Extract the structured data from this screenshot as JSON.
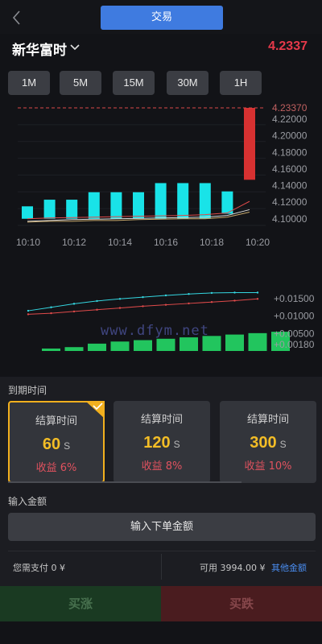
{
  "header": {
    "tab_label": "交易"
  },
  "symbol": {
    "name": "新华富时",
    "price": "4.2337"
  },
  "timeframes": [
    {
      "label": "1M",
      "active": true
    },
    {
      "label": "5M",
      "active": false
    },
    {
      "label": "15M",
      "active": false
    },
    {
      "label": "30M",
      "active": false
    },
    {
      "label": "1H",
      "active": false
    }
  ],
  "chart_data": {
    "type": "bar",
    "price_axis": [
      "4.23370",
      "4.22000",
      "4.20000",
      "4.18000",
      "4.16000",
      "4.14000",
      "4.12000",
      "4.10000"
    ],
    "time_axis": [
      "10:10",
      "10:12",
      "10:14",
      "10:16",
      "10:18",
      "10:20"
    ],
    "price_ylim": [
      4.092,
      4.2337
    ],
    "current_price": 4.2337,
    "bars": [
      {
        "base": 4.1,
        "top": 4.115
      },
      {
        "base": 4.1,
        "top": 4.123
      },
      {
        "base": 4.1,
        "top": 4.123
      },
      {
        "base": 4.1,
        "top": 4.132
      },
      {
        "base": 4.1,
        "top": 4.132
      },
      {
        "base": 4.1,
        "top": 4.132
      },
      {
        "base": 4.1,
        "top": 4.143
      },
      {
        "base": 4.1,
        "top": 4.143
      },
      {
        "base": 4.1,
        "top": 4.143
      },
      {
        "base": 4.106,
        "top": 4.133
      },
      {
        "base": 4.147,
        "top": 4.2337,
        "down": true
      }
    ],
    "indicator_axis": [
      "+0.01500",
      "+0.01000",
      "+0.00500",
      "+0.00180"
    ],
    "indicator_ylim": [
      0.0,
      0.0175
    ],
    "volume_bars": [
      0.0007,
      0.0011,
      0.0021,
      0.0027,
      0.0031,
      0.0035,
      0.0039,
      0.0043,
      0.0047,
      0.0051,
      0.0055
    ],
    "line_cyan": [
      0.0115,
      0.0125,
      0.0135,
      0.0143,
      0.0149,
      0.0154,
      0.0159,
      0.0163,
      0.0166,
      0.0167,
      0.0167
    ],
    "line_red": [
      0.0105,
      0.0108,
      0.0113,
      0.0118,
      0.0123,
      0.0128,
      0.0132,
      0.0136,
      0.014,
      0.0144,
      0.0149
    ]
  },
  "watermark": "www.dfym.net",
  "colors": {
    "accent": "#3f7be0",
    "price_red": "#e6394a",
    "bar_cyan": "#19e3e8",
    "bar_red": "#d73131",
    "vol_green": "#22c55e",
    "gold": "#f3bd26"
  },
  "expiry": {
    "label": "到期时间",
    "options": [
      {
        "title": "结算时间",
        "value": "60",
        "unit": "S",
        "profit": "收益 6%",
        "selected": true
      },
      {
        "title": "结算时间",
        "value": "120",
        "unit": "S",
        "profit": "收益 8%",
        "selected": false
      },
      {
        "title": "结算时间",
        "value": "300",
        "unit": "S",
        "profit": "收益 10%",
        "selected": false
      }
    ]
  },
  "amount": {
    "label": "输入金额",
    "placeholder": "输入下单金额",
    "pay_text": "您需支付 0 ¥",
    "available_text": "可用 3994.00 ¥",
    "other_amount": "其他金额"
  },
  "actions": {
    "buy_up": "买涨",
    "buy_down": "买跌"
  }
}
